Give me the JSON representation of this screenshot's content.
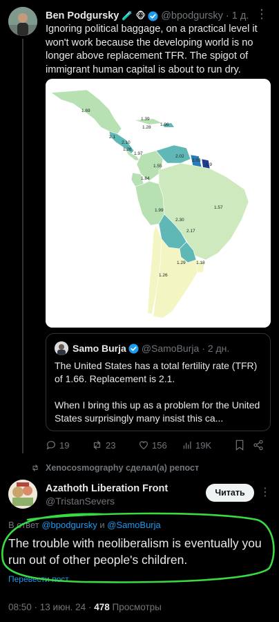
{
  "tweet": {
    "author_name": "Ben Podgursky",
    "author_emojis": "🧪 🐵",
    "handle": "@bpodgursky",
    "time": "· 1 д.",
    "text": "Ignoring political baggage, on a practical level it won't work because the developing world is no longer above replacement TFR.  The spigot of immigrant human capital is about to run dry.",
    "map": {
      "colors": {
        "light": "#f3f6c2",
        "mid": "#b7e1b3",
        "teal": "#5fb8b6",
        "blue": "#2b7bb6",
        "dark": "#1d3f8f"
      },
      "labels": [
        "1.69",
        "1.39",
        "1.96",
        "1.28",
        "2.1",
        "2.10",
        "1.26",
        "1.97",
        "2.02",
        "2.03",
        "1.9",
        "1.55",
        "1.84",
        "1.57",
        "1.99",
        "2.30",
        "2.17",
        "1.29",
        "1.18",
        "1.26"
      ]
    },
    "quote": {
      "author_name": "Samo Burja",
      "handle": "@SamoBurja",
      "time": "· 2 дн.",
      "text_1": "The United States has a total fertility rate (TFR) of 1.66. Replacement is 2.1.",
      "text_2": "When I bring this up as a problem for the United States surprisingly many insist this ca..."
    },
    "stats": {
      "replies": "19",
      "reposts": "23",
      "likes": "156",
      "views": "19K"
    }
  },
  "repost": {
    "label": "Xenocosmography сделал(а) репост"
  },
  "reply": {
    "author_name": "Azathoth Liberation Front",
    "handle": "@TristanSevers",
    "follow_label": "Читать",
    "reply_prefix": "В ответ",
    "reply_user_1": "@bpodgursky",
    "reply_conj": "и",
    "reply_user_2": "@SamoBurja",
    "text": "The trouble with neoliberalism is eventually you run out of other people's children.",
    "translate_label": "Перевести пост",
    "time": "08:50 · 13 июн. 24 ·",
    "views_count": "478",
    "views_label": "Просмотры"
  }
}
